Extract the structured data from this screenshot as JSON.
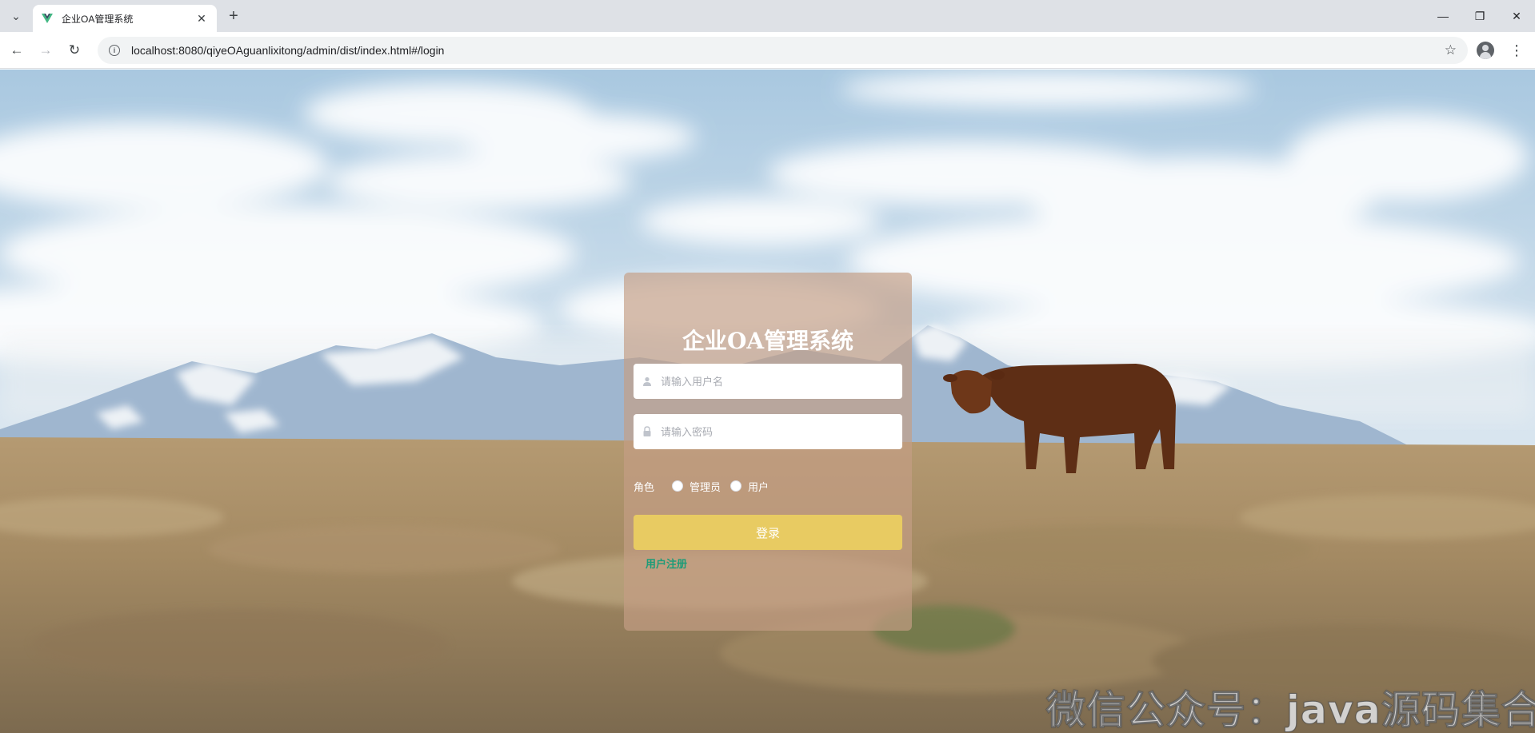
{
  "browser": {
    "tab_title": "企业OA管理系统",
    "url": "localhost:8080/qiyeOAguanlixitong/admin/dist/index.html#/login",
    "icons": {
      "tab_list": "chevron-down-icon",
      "close": "close-icon",
      "new_tab": "plus-icon",
      "back": "arrow-left-icon",
      "forward": "arrow-right-icon",
      "reload": "reload-icon",
      "info": "info-icon",
      "bookmark": "star-icon",
      "profile": "profile-icon",
      "menu": "more-vert-icon"
    }
  },
  "login": {
    "title": "企业OA管理系统",
    "username_placeholder": "请输入用户名",
    "password_placeholder": "请输入密码",
    "role_label": "角色",
    "role_options": [
      "管理员",
      "用户"
    ],
    "login_button": "登录",
    "register_link": "用户注册"
  },
  "watermark": "微信公众号：java源码集合",
  "colors": {
    "card_bg": "#c49e84",
    "button_bg": "#e8cb62",
    "link": "#1e9c78"
  }
}
